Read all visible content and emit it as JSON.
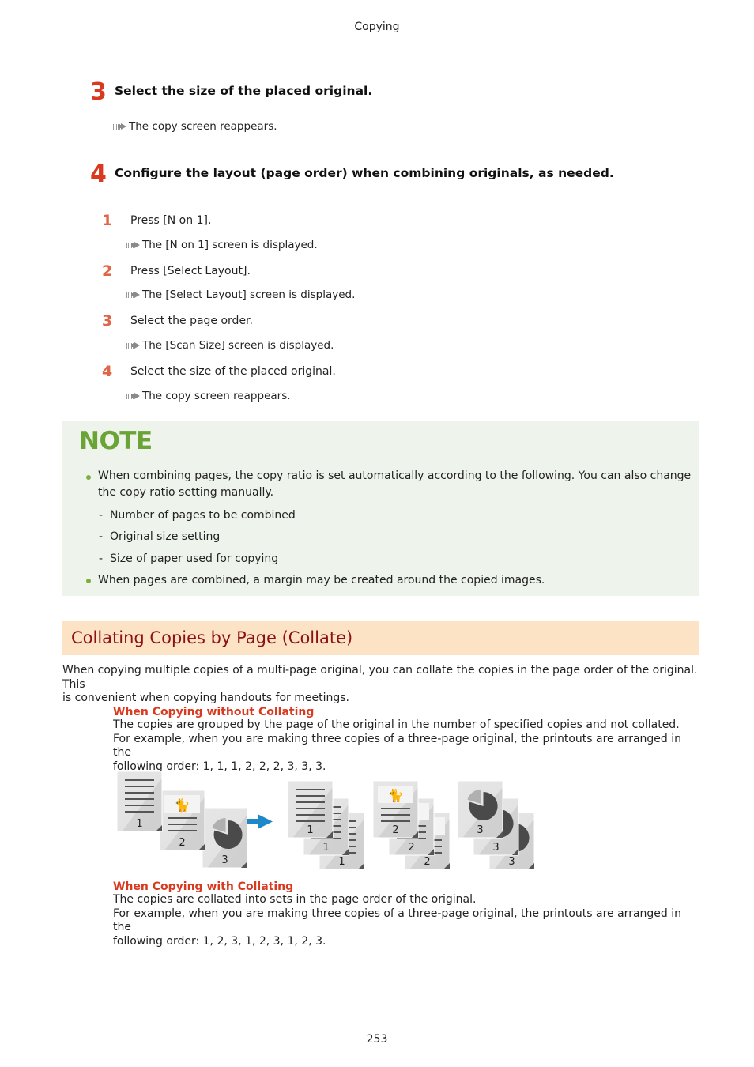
{
  "header": {
    "title": "Copying"
  },
  "steps": [
    {
      "number": "3",
      "title": "Select the size of the placed original.",
      "result": "The copy screen reappears."
    },
    {
      "number": "4",
      "title": "Configure the layout (page order) when combining originals, as needed.",
      "substeps": [
        {
          "number": "1",
          "text": "Press [N on 1].",
          "result": "The [N on 1] screen is displayed."
        },
        {
          "number": "2",
          "text": "Press [Select Layout].",
          "result": "The [Select Layout] screen is displayed."
        },
        {
          "number": "3",
          "text": "Select the page order.",
          "result": "The [Scan Size] screen is displayed."
        },
        {
          "number": "4",
          "text": "Select the size of the placed original.",
          "result": "The copy screen reappears."
        }
      ]
    }
  ],
  "note": {
    "title": "NOTE",
    "bullets": [
      {
        "text_line1": "When combining pages, the copy ratio is set automatically according to the following. You can also change",
        "text_line2": "the copy ratio setting manually.",
        "subitems": [
          "Number of pages to be combined",
          "Original size setting",
          "Size of paper used for copying"
        ]
      },
      {
        "text_line1": "When pages are combined, a margin may be created around the copied images."
      }
    ]
  },
  "section": {
    "title": "Collating Copies by Page (Collate)",
    "intro_line1": "When copying multiple copies of a multi-page original, you can collate the copies in the page order of the original. This",
    "intro_line2": "is convenient when copying handouts for meetings.",
    "without": {
      "heading": "When Copying without Collating",
      "line1": "The copies are grouped by the page of the original in the number of specified copies and not collated.",
      "line2": "For example, when you are making three copies of a three-page original, the printouts are arranged in the",
      "line3": "following order: 1, 1, 1, 2, 2, 2, 3, 3, 3."
    },
    "with": {
      "heading": "When Copying with Collating",
      "line1": "The copies are collated into sets in the page order of the original.",
      "line2": "For example, when you are making three copies of a three-page original, the printouts are arranged in the",
      "line3": "following order: 1, 2, 3, 1, 2, 3, 1, 2, 3."
    },
    "illustration": {
      "original_pages": [
        "1",
        "2",
        "3"
      ],
      "output_groups": [
        [
          "1",
          "1",
          "1"
        ],
        [
          "2",
          "2",
          "2"
        ],
        [
          "3",
          "3",
          "3"
        ]
      ],
      "arrow_color": "#1e88c9"
    }
  },
  "footer": {
    "page_number": "253"
  }
}
